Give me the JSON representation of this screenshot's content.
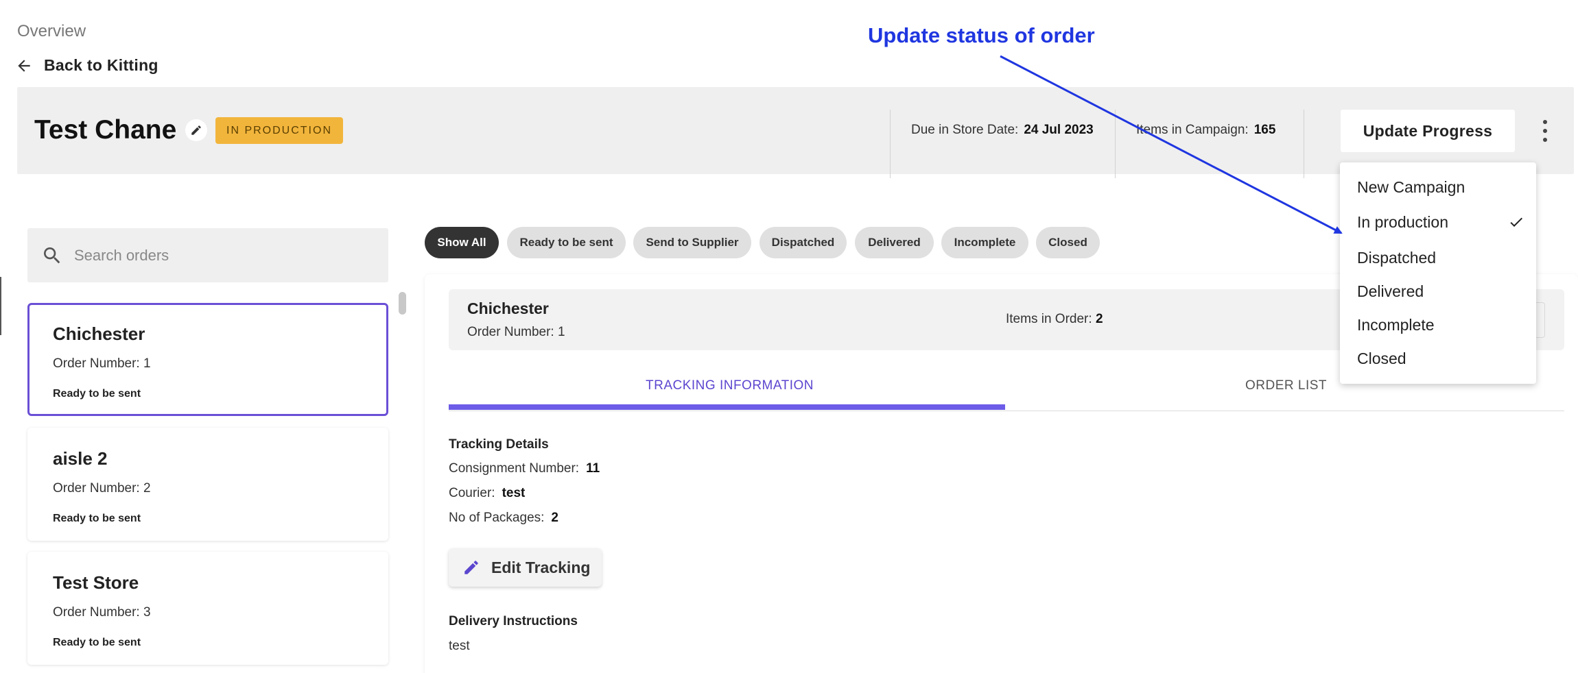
{
  "breadcrumb": {
    "label": "Overview"
  },
  "back_link": {
    "label": "Back to Kitting"
  },
  "annotation": {
    "text": "Update status of order",
    "color": "#1f36e0"
  },
  "campaign": {
    "title": "Test Chane",
    "status": "IN PRODUCTION",
    "due_label": "Due in Store Date:",
    "due_value": "24 Jul 2023",
    "items_label": "Items in Campaign:",
    "items_value": "165",
    "update_button": "Update Progress"
  },
  "search": {
    "placeholder": "Search orders"
  },
  "orders": [
    {
      "name": "Chichester",
      "number": "Order Number: 1",
      "status": "Ready to be sent",
      "selected": true
    },
    {
      "name": "aisle 2",
      "number": "Order Number: 2",
      "status": "Ready to be sent",
      "selected": false
    },
    {
      "name": "Test Store",
      "number": "Order Number: 3",
      "status": "Ready to be sent",
      "selected": false
    }
  ],
  "filters": [
    {
      "label": "Show All",
      "active": true
    },
    {
      "label": "Ready to be sent",
      "active": false
    },
    {
      "label": "Send to Supplier",
      "active": false
    },
    {
      "label": "Dispatched",
      "active": false
    },
    {
      "label": "Delivered",
      "active": false
    },
    {
      "label": "Incomplete",
      "active": false
    },
    {
      "label": "Closed",
      "active": false
    }
  ],
  "order_detail": {
    "name": "Chichester",
    "number": "Order Number: 1",
    "items_label": "Items in Order:",
    "items_value": "2",
    "tabs": [
      "TRACKING INFORMATION",
      "ORDER LIST"
    ],
    "active_tab": 0,
    "tracking": {
      "heading": "Tracking Details",
      "consignment_label": "Consignment Number:",
      "consignment_value": "11",
      "courier_label": "Courier:",
      "courier_value": "test",
      "packages_label": "No of Packages:",
      "packages_value": "2",
      "edit_button": "Edit Tracking"
    },
    "delivery": {
      "heading": "Delivery Instructions",
      "value": "test"
    }
  },
  "status_menu": {
    "items": [
      "New Campaign",
      "In production",
      "Dispatched",
      "Delivered",
      "Incomplete",
      "Closed"
    ],
    "checked_index": 1
  },
  "colors": {
    "accent": "#6c5ce7",
    "badge": "#f2b53c",
    "chip_active": "#333333"
  },
  "icons": [
    "arrow-left-icon",
    "pencil-icon",
    "search-icon",
    "more-vert-icon",
    "check-icon"
  ]
}
